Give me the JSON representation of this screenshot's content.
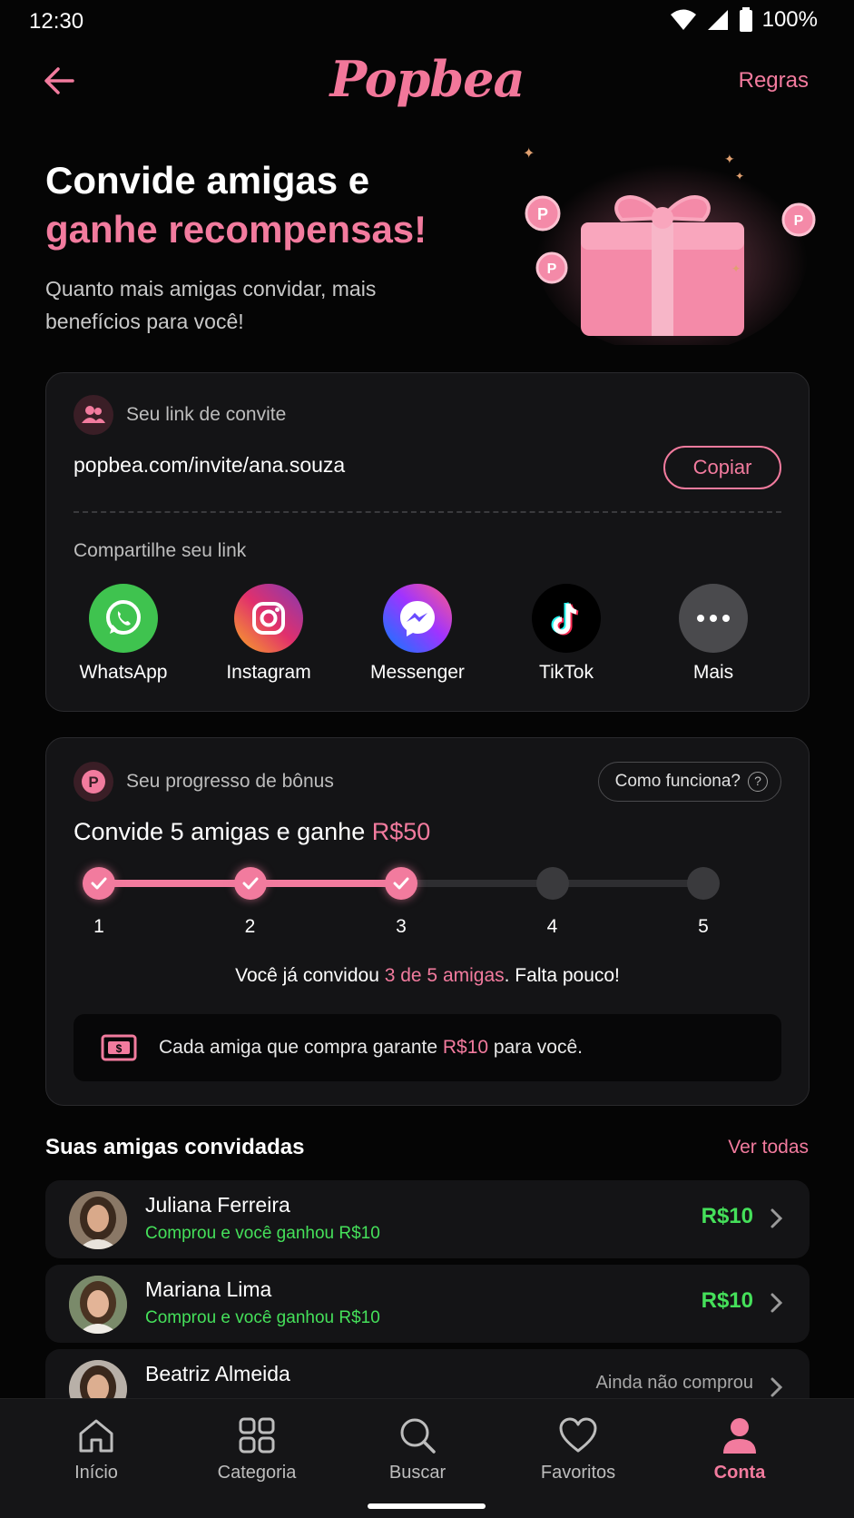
{
  "status": {
    "time": "12:30",
    "battery": "100%"
  },
  "header": {
    "logo": "Popbea",
    "rules": "Regras"
  },
  "hero": {
    "title_line1": "Convide amigas e",
    "title_line2": "ganhe recompensas!",
    "subtitle": "Quanto mais amigas convidar, mais benefícios para você!"
  },
  "invite": {
    "label": "Seu link de convite",
    "link": "popbea.com/invite/ana.souza",
    "copy": "Copiar",
    "share_label": "Compartilhe seu link",
    "shares": [
      "WhatsApp",
      "Instagram",
      "Messenger",
      "TikTok",
      "Mais"
    ]
  },
  "bonus": {
    "label": "Seu progresso de bônus",
    "how": "Como funciona?",
    "goal_text": "Convide 5 amigas e ganhe ",
    "goal_amount": "R$50",
    "steps": [
      "1",
      "2",
      "3",
      "4",
      "5"
    ],
    "completed": 3,
    "progress_pre": "Você já convidou ",
    "progress_hl": "3 de 5 amigas",
    "progress_post": ". Falta pouco!",
    "info_pre": "Cada amiga que compra garante ",
    "info_hl": "R$10",
    "info_post": " para você."
  },
  "friends": {
    "title": "Suas amigas convidadas",
    "see_all": "Ver todas",
    "items": [
      {
        "name": "Juliana Ferreira",
        "status": "Comprou e você ganhou R$10",
        "reward": "R$10"
      },
      {
        "name": "Mariana Lima",
        "status": "Comprou e você ganhou R$10",
        "reward": "R$10"
      },
      {
        "name": "Beatriz Almeida",
        "status": "Ainda não comprou"
      }
    ]
  },
  "nav": [
    "Início",
    "Categoria",
    "Buscar",
    "Favoritos",
    "Conta"
  ],
  "colors": {
    "accent": "#f27b9e",
    "success": "#45e05a",
    "background": "#050505",
    "card": "#141416"
  }
}
